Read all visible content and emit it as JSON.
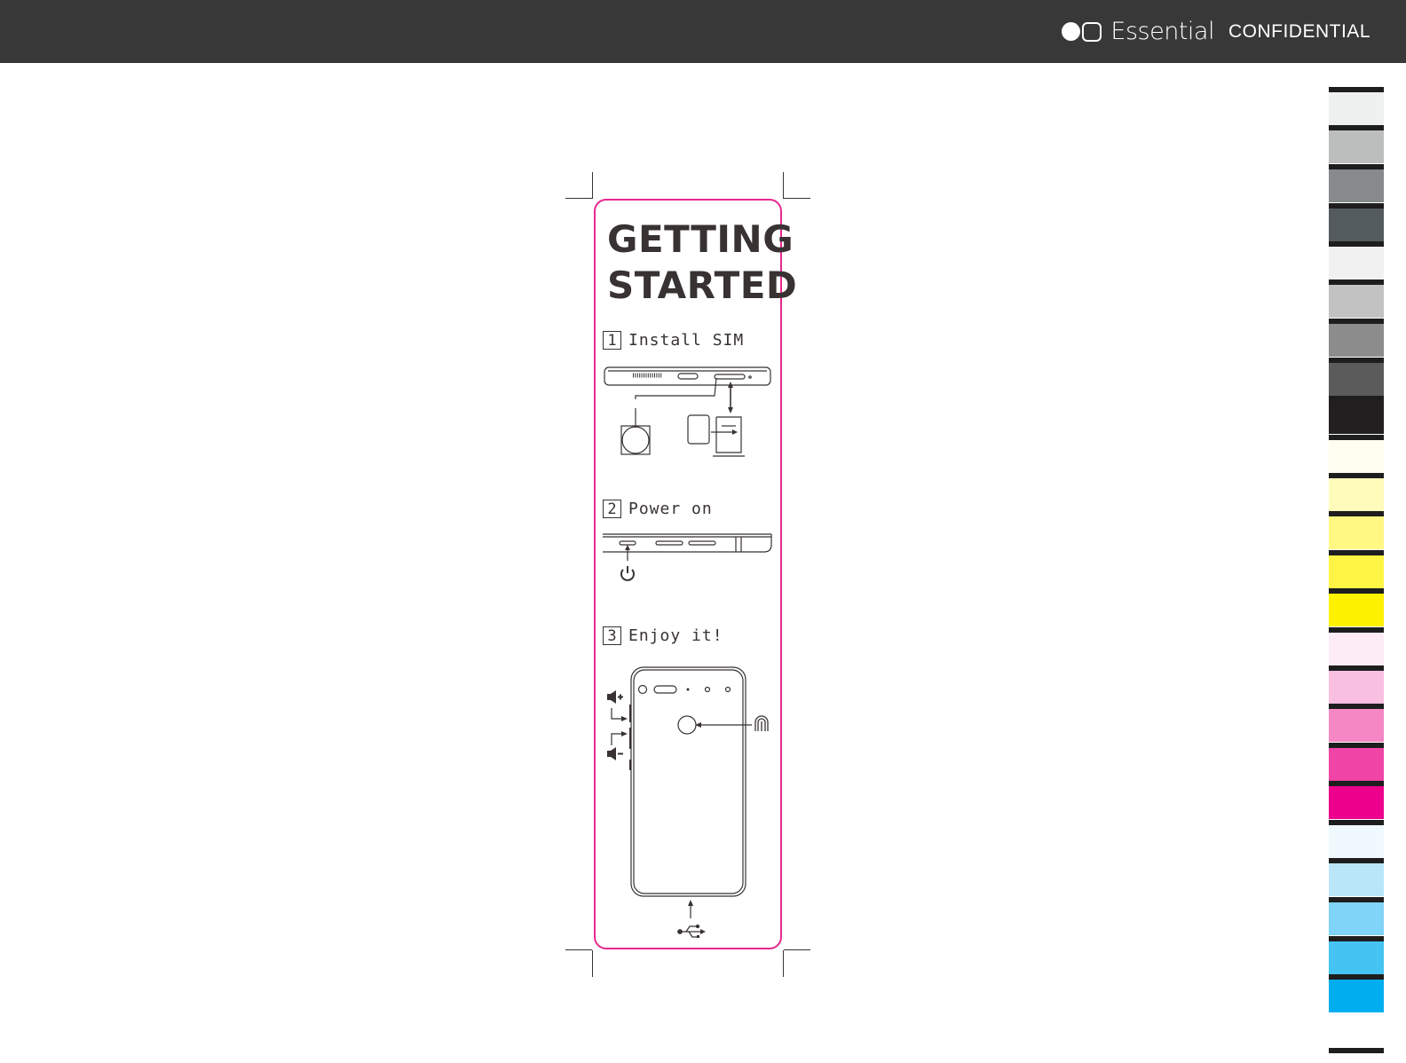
{
  "header": {
    "brand_name": "Essential",
    "tag": "CONFIDENTIAL",
    "logo_icon": "essential-logo-icon"
  },
  "card": {
    "title_line1": "GETTING",
    "title_line2": "STARTED",
    "steps": [
      {
        "number": "1",
        "label": "Install SIM"
      },
      {
        "number": "2",
        "label": "Power on"
      },
      {
        "number": "3",
        "label": "Enjoy it!"
      }
    ],
    "icons": [
      "sim-tray-icon",
      "sim-eject-tool-icon",
      "sim-card-icon",
      "power-icon",
      "volume-up-icon",
      "volume-down-icon",
      "fingerprint-icon",
      "usb-icon"
    ],
    "border_color": "#e8278f"
  },
  "color_bar": [
    "#eff0f0",
    "#bcbdbd",
    "#868a8c",
    "#545b5e",
    "#f1f1f1",
    "#c2c2c2",
    "#8c8c8c",
    "#5b5b5b",
    "#231f20",
    "#fffef0",
    "#fffbbb",
    "#fff883",
    "#fff545",
    "#fff200",
    "#fdecf5",
    "#f9bfe0",
    "#f487c4",
    "#f045a6",
    "#ec008c",
    "#f0f9fe",
    "#bae6fa",
    "#7fd4f7",
    "#45c3f3",
    "#00aeef"
  ]
}
